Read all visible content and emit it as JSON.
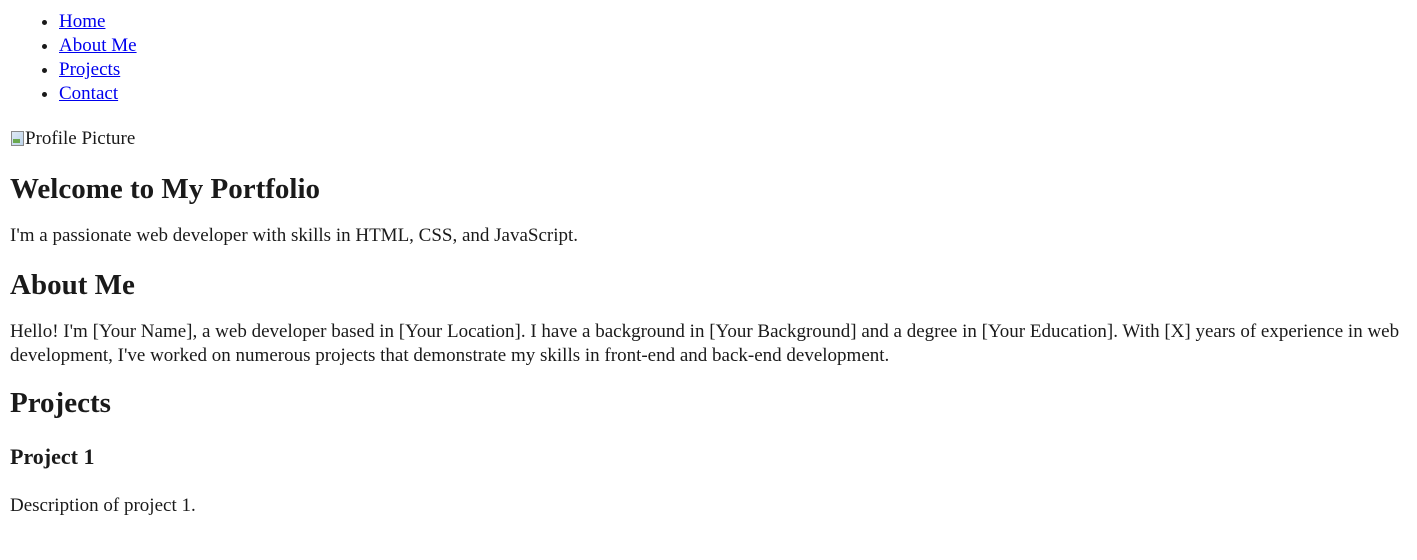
{
  "nav": {
    "items": [
      {
        "label": "Home"
      },
      {
        "label": "About Me"
      },
      {
        "label": "Projects"
      },
      {
        "label": "Contact"
      }
    ]
  },
  "profile": {
    "alt_text": "Profile Picture",
    "icon": "broken-image-icon"
  },
  "hero": {
    "title": "Welcome to My Portfolio",
    "text": "I'm a passionate web developer with skills in HTML, CSS, and JavaScript."
  },
  "about": {
    "title": "About Me",
    "text": "Hello! I'm [Your Name], a web developer based in [Your Location]. I have a background in [Your Background] and a degree in [Your Education]. With [X] years of experience in web development, I've worked on numerous projects that demonstrate my skills in front-end and back-end development."
  },
  "projects": {
    "title": "Projects",
    "items": [
      {
        "title": "Project 1",
        "description": "Description of project 1."
      }
    ]
  },
  "colors": {
    "link": "#0000ee",
    "text": "#1a1a1a",
    "background": "#ffffff"
  }
}
